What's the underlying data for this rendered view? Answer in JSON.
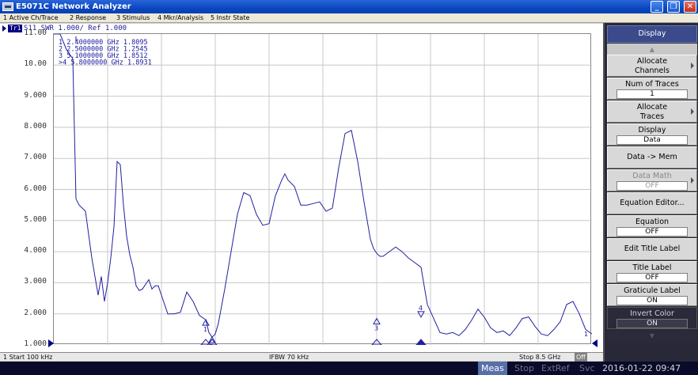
{
  "window": {
    "title": "E5071C Network Analyzer",
    "btn_min": "_",
    "btn_max": "❐",
    "btn_close": "✕"
  },
  "menu": [
    "1 Active Ch/Trace",
    "2 Response",
    "3 Stimulus",
    "4 Mkr/Analysis",
    "5 Instr State"
  ],
  "trace": {
    "label": "Tr1",
    "info": "S11  SWR 1.000/ Ref 1.000"
  },
  "y_ticks": [
    "11.00",
    "10.00",
    "9.000",
    "8.000",
    "7.000",
    "6.000",
    "5.000",
    "4.000",
    "3.000",
    "2.000",
    "1.000"
  ],
  "markers": [
    {
      "id": "1",
      "freq": "2.4000000 GHz",
      "value": "1.8095"
    },
    {
      "id": "2",
      "freq": "2.5000000 GHz",
      "value": "1.2545"
    },
    {
      "id": "3",
      "freq": "5.1000000 GHz",
      "value": "1.8512"
    },
    {
      "id": ">4",
      "freq": "5.8000000 GHz",
      "value": "1.8931"
    }
  ],
  "status": {
    "start": "1  Start 100 kHz",
    "ifbw": "IFBW 70 kHz",
    "stop": "Stop 8.5 GHz",
    "off": "Off"
  },
  "bottom": {
    "meas": "Meas",
    "stop": "Stop",
    "extref": "ExtRef",
    "svc": "Svc",
    "datetime": "2016-01-22 09:47"
  },
  "softkeys": {
    "title": "Display",
    "allocate_channels": "Allocate Channels",
    "num_traces": "Num of Traces",
    "num_traces_val": "1",
    "allocate_traces": "Allocate Traces",
    "display": "Display",
    "display_val": "Data",
    "data_to_mem": "Data -> Mem",
    "data_math": "Data Math",
    "data_math_val": "OFF",
    "equation_editor": "Equation Editor...",
    "equation": "Equation",
    "equation_val": "OFF",
    "edit_title": "Edit Title Label",
    "title_label": "Title Label",
    "title_label_val": "OFF",
    "graticule": "Graticule Label",
    "graticule_val": "ON",
    "invert_color": "Invert Color",
    "invert_color_val": "ON"
  },
  "chart_data": {
    "type": "line",
    "ylim": [
      1.0,
      11.0
    ],
    "xlim_ghz": [
      0.0001,
      8.5
    ],
    "grid": true,
    "series": [
      {
        "x": [
          0.0001,
          0.1,
          0.2,
          0.3,
          0.35,
          0.4,
          0.5,
          0.6,
          0.7,
          0.75,
          0.8,
          0.85,
          0.9,
          0.95,
          1.0,
          1.05,
          1.1,
          1.15,
          1.2,
          1.25,
          1.3,
          1.35,
          1.4,
          1.5,
          1.55,
          1.6,
          1.65,
          1.7,
          1.8,
          1.9,
          2.0,
          2.1,
          2.2,
          2.3,
          2.4,
          2.45,
          2.5,
          2.55,
          2.6,
          2.7,
          2.8,
          2.9,
          3.0,
          3.1,
          3.2,
          3.3,
          3.4,
          3.5,
          3.6,
          3.65,
          3.7,
          3.8,
          3.9,
          4.0,
          4.1,
          4.2,
          4.3,
          4.4,
          4.5,
          4.6,
          4.7,
          4.8,
          4.9,
          5.0,
          5.05,
          5.1,
          5.15,
          5.2,
          5.3,
          5.4,
          5.5,
          5.6,
          5.7,
          5.8,
          5.9,
          6.0,
          6.1,
          6.2,
          6.3,
          6.4,
          6.5,
          6.6,
          6.7,
          6.8,
          6.9,
          7.0,
          7.1,
          7.2,
          7.3,
          7.4,
          7.5,
          7.6,
          7.7,
          7.8,
          7.9,
          8.0,
          8.1,
          8.2,
          8.3,
          8.4,
          8.5
        ],
        "y": [
          11.0,
          11.0,
          10.5,
          10.2,
          5.7,
          5.5,
          5.3,
          3.8,
          2.6,
          3.2,
          2.4,
          3.0,
          3.8,
          4.8,
          6.9,
          6.8,
          5.5,
          4.5,
          3.9,
          3.5,
          2.9,
          2.75,
          2.8,
          3.1,
          2.8,
          2.9,
          2.9,
          2.6,
          2.0,
          2.0,
          2.05,
          2.7,
          2.4,
          1.95,
          1.81,
          1.4,
          1.25,
          1.35,
          1.7,
          2.8,
          4.0,
          5.2,
          5.9,
          5.8,
          5.2,
          4.85,
          4.9,
          5.8,
          6.3,
          6.5,
          6.3,
          6.1,
          5.5,
          5.5,
          5.55,
          5.6,
          5.3,
          5.4,
          6.7,
          7.8,
          7.9,
          6.9,
          5.6,
          4.4,
          4.1,
          3.95,
          3.85,
          3.85,
          4.0,
          4.15,
          4.0,
          3.8,
          3.65,
          3.5,
          2.3,
          1.85,
          1.4,
          1.35,
          1.4,
          1.3,
          1.5,
          1.8,
          2.15,
          1.89,
          1.55,
          1.4,
          1.45,
          1.3,
          1.55,
          1.85,
          1.9,
          1.6,
          1.35,
          1.3,
          1.5,
          1.75,
          2.3,
          2.4,
          2.0,
          1.5,
          1.35
        ]
      }
    ]
  }
}
